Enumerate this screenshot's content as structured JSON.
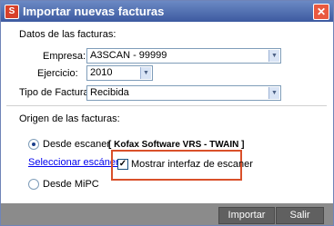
{
  "window": {
    "title": "Importar nuevas facturas",
    "close_glyph": "✕",
    "icon": "app-icon",
    "icon_glyph": "S"
  },
  "datos": {
    "heading": "Datos de las facturas:",
    "empresa_label": "Empresa:",
    "empresa_value": "A3SCAN - 99999",
    "ejercicio_label": "Ejercicio:",
    "ejercicio_value": "2010",
    "tipo_label": "Tipo de Factura:",
    "tipo_value": "Recibida"
  },
  "origen": {
    "heading": "Origen de las facturas:",
    "desde_escaner": "Desde escaner",
    "scanner_name": "[ Kofax Software VRS - TWAIN ]",
    "seleccionar": "Seleccionar escáner",
    "mostrar_interfaz": "Mostrar interfaz de escaner",
    "mostrar_checked": "✓",
    "desde_mipc": "Desde MiPC"
  },
  "buttons": {
    "importar": "Importar",
    "salir": "Salir"
  },
  "colors": {
    "titlebar": "#3d5aa0",
    "highlight": "#d9502a",
    "footer": "#8b8b8b"
  }
}
